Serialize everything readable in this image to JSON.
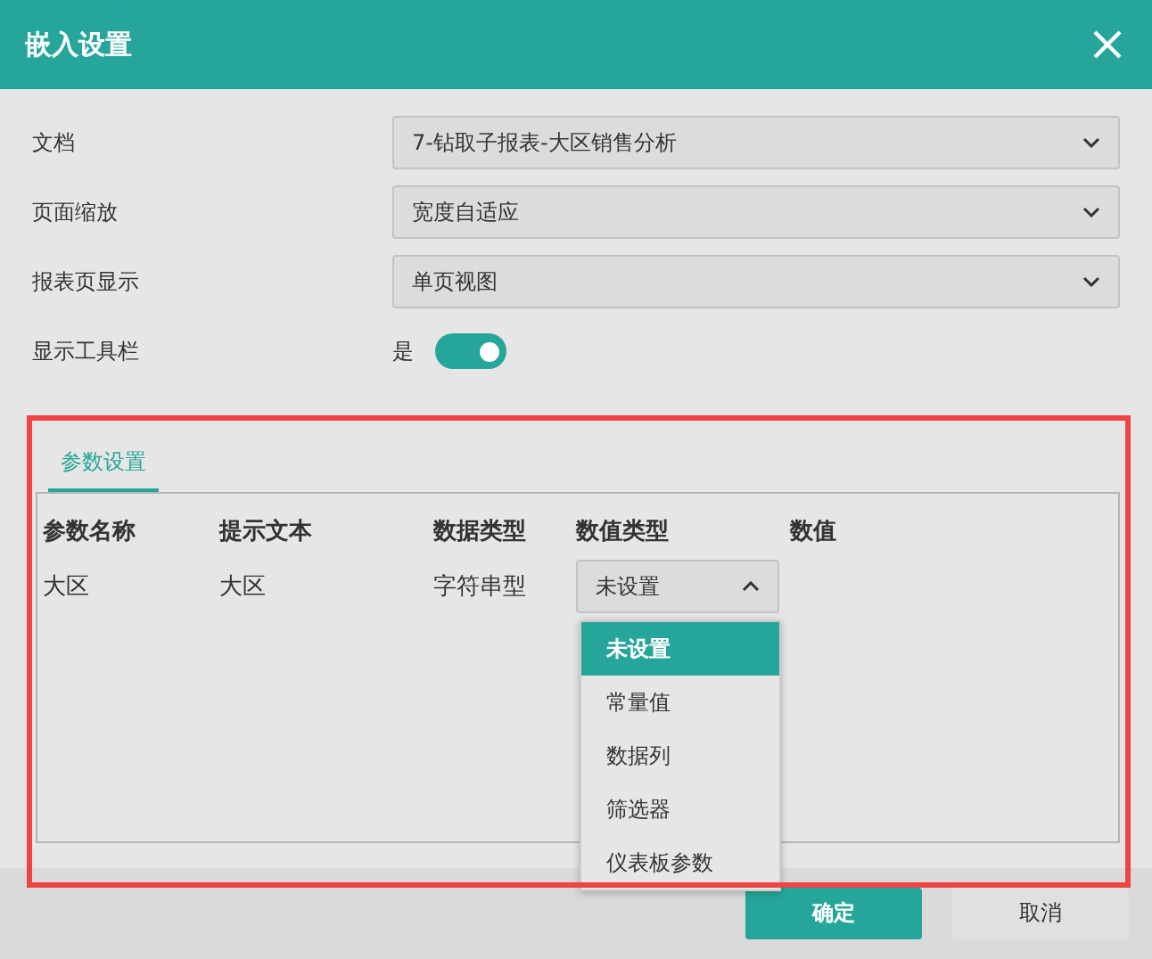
{
  "window": {
    "title": "嵌入设置"
  },
  "form": [
    {
      "kind": "select",
      "label": "文档",
      "value": "7-钻取子报表-大区销售分析"
    },
    {
      "kind": "select",
      "label": "页面缩放",
      "value": "宽度自适应"
    },
    {
      "kind": "select",
      "label": "报表页显示",
      "value": "单页视图"
    },
    {
      "kind": "toggle",
      "label": "显示工具栏",
      "value": "是",
      "on": true
    }
  ],
  "params_panel": {
    "highlighted": true,
    "tabs": [
      {
        "label": "参数设置",
        "selected": true
      }
    ],
    "columns": [
      "参数名称",
      "提示文本",
      "数据类型",
      "数值类型",
      "数值"
    ],
    "rows": [
      {
        "name": "大区",
        "prompt": "大区",
        "data_type": "字符串型",
        "value_type": {
          "value": "未设置",
          "expanded": true,
          "options": [
            {
              "label": "未设置",
              "selected": true
            },
            {
              "label": "常量值",
              "selected": false
            },
            {
              "label": "数据列",
              "selected": false
            },
            {
              "label": "筛选器",
              "selected": false
            },
            {
              "label": "仪表板参数",
              "selected": false
            }
          ]
        }
      }
    ]
  },
  "buttons": [
    {
      "label": "确定",
      "kind": "primary"
    },
    {
      "label": "取消",
      "kind": "secondary"
    }
  ]
}
